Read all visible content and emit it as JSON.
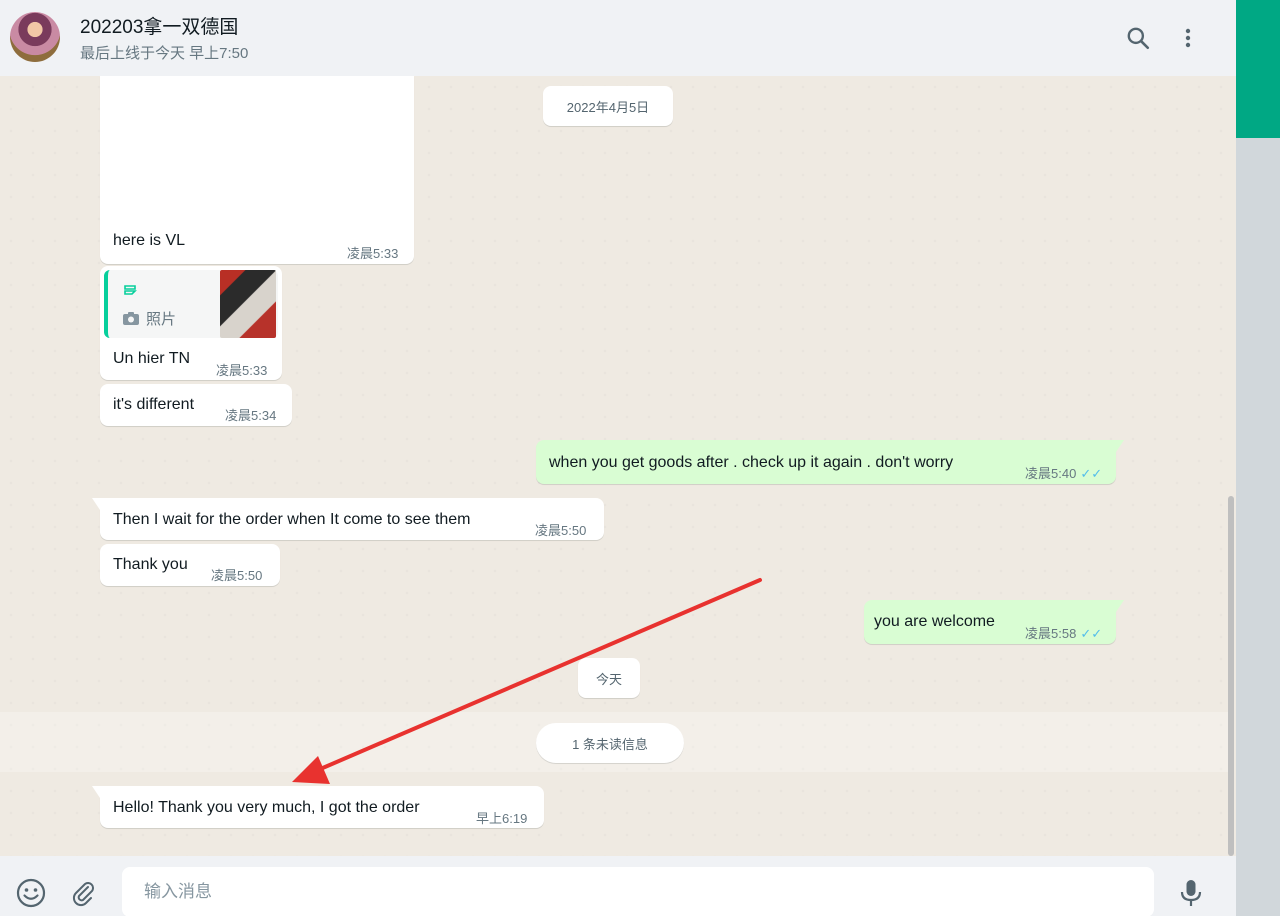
{
  "header": {
    "title": "202203拿一双德国",
    "status": "最后上线于今天 早上7:50",
    "icons": [
      "search-icon",
      "more-vertical-icon"
    ]
  },
  "messages": {
    "date_1": "2022年4月5日",
    "m1": {
      "text": "here is VL",
      "time": "凌晨5:33"
    },
    "m2": {
      "quote_kind": "照片",
      "text": "Un hier TN",
      "time": "凌晨5:33"
    },
    "m3": {
      "text": "it's different",
      "time": "凌晨5:34"
    },
    "m4": {
      "text": "when you get goods after . check up it again . don't worry",
      "time": "凌晨5:40"
    },
    "m5": {
      "text": "Then I wait for the order when It come to see them",
      "time": "凌晨5:50"
    },
    "m6": {
      "text": "Thank you",
      "time": "凌晨5:50"
    },
    "m7": {
      "text": "you are welcome",
      "time": "凌晨5:58"
    },
    "date_2": "今天",
    "unread": "1 条未读信息",
    "m8": {
      "text": "Hello! Thank you very much, I got the order",
      "time": "早上6:19"
    }
  },
  "composer": {
    "placeholder": "输入消息",
    "icons": [
      "emoji-icon",
      "attach-icon",
      "mic-icon"
    ]
  },
  "colors": {
    "accent": "#00a884",
    "outgoing_bubble": "#d9fdd3",
    "read_ticks": "#53bdeb",
    "annotation_arrow": "#e8322f"
  }
}
